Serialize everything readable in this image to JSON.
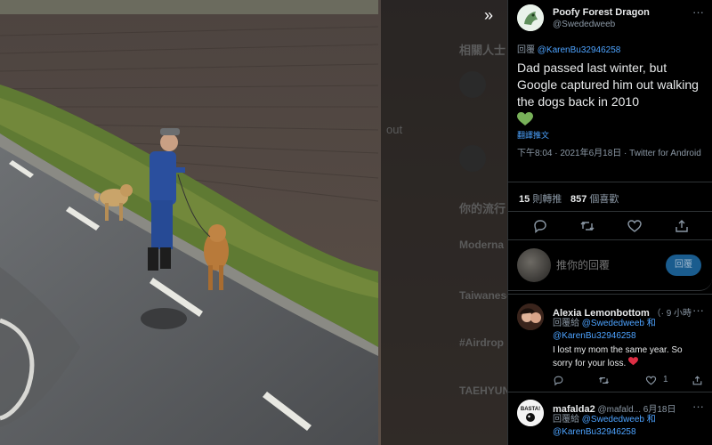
{
  "page_bg_ghost": {
    "heading": "相關人士",
    "trending_heading": "你的流行",
    "items": [
      "Moderna",
      "Taiwanese",
      "#Airdrop",
      "TAEHYUN"
    ],
    "out_word": "out"
  },
  "expand_icon": "double-chevron-right-icon",
  "tweet": {
    "author_name": "Poofy Forest Dragon",
    "author_handle": "@Swededweeb",
    "reply_prefix": "回覆",
    "reply_to": "@KarenBu32946258",
    "text": "Dad passed last winter, but Google captured him out walking the dogs back in 2010",
    "emoji": "green-heart",
    "translate": "翻譯推文",
    "meta": "下午8:04 · 2021年6月18日 · Twitter for Android",
    "retweets_count": "15",
    "retweets_label": "則轉推",
    "likes_count": "857",
    "likes_label": "個喜歡",
    "more_icon": "more-icon"
  },
  "reply_box": {
    "placeholder": "推你的回覆",
    "button_label": "回覆"
  },
  "replies": [
    {
      "name": "Alexia Lemonbottom",
      "handle": "（·",
      "time": "9 小時",
      "to_prefix": "回覆給",
      "to_line1": "@Swededweeb 和",
      "to_line2": "@KarenBu32946258",
      "text": "I lost my mom the same year. So sorry for your loss.",
      "emoji": "red-heart",
      "likes": "1"
    },
    {
      "name": "mafalda2",
      "handle": "@mafald...",
      "time": "6月18日",
      "to_prefix": "回覆給",
      "to_line1": "@Swededweeb 和",
      "to_line2": "@KarenBu32946258",
      "avatar_text": "BASTA!"
    }
  ],
  "colors": {
    "link": "#4da3ff",
    "heart_green": "#78b159",
    "heart_red": "#dd2e44",
    "reply_button": "#1a5c8e"
  }
}
